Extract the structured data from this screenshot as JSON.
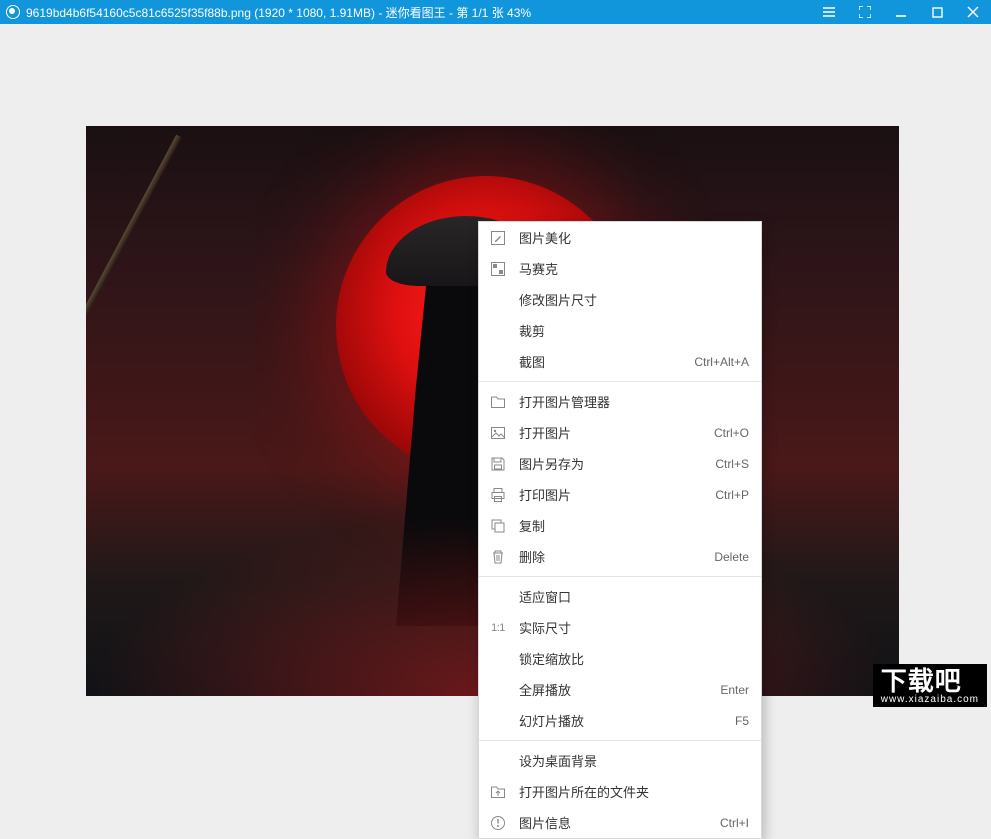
{
  "titlebar": {
    "filename": "9619bd4b6f54160c5c81c6525f35f88b.png",
    "dimensions": "(1920 * 1080, 1.91MB)",
    "appname": "迷你看图王",
    "position": "第 1/1 张",
    "zoom": "43%"
  },
  "menu": {
    "groups": [
      [
        {
          "icon": "edit",
          "label": "图片美化",
          "shortcut": ""
        },
        {
          "icon": "mosaic",
          "label": "马赛克",
          "shortcut": ""
        },
        {
          "icon": "",
          "label": "修改图片尺寸",
          "shortcut": ""
        },
        {
          "icon": "",
          "label": "裁剪",
          "shortcut": ""
        },
        {
          "icon": "",
          "label": "截图",
          "shortcut": "Ctrl+Alt+A"
        }
      ],
      [
        {
          "icon": "folder",
          "label": "打开图片管理器",
          "shortcut": ""
        },
        {
          "icon": "image",
          "label": "打开图片",
          "shortcut": "Ctrl+O"
        },
        {
          "icon": "save",
          "label": "图片另存为",
          "shortcut": "Ctrl+S"
        },
        {
          "icon": "print",
          "label": "打印图片",
          "shortcut": "Ctrl+P"
        },
        {
          "icon": "copy",
          "label": "复制",
          "shortcut": ""
        },
        {
          "icon": "trash",
          "label": "删除",
          "shortcut": "Delete"
        }
      ],
      [
        {
          "icon": "",
          "label": "适应窗口",
          "shortcut": ""
        },
        {
          "icon": "ratio",
          "label": "实际尺寸",
          "shortcut": ""
        },
        {
          "icon": "",
          "label": "锁定缩放比",
          "shortcut": ""
        },
        {
          "icon": "",
          "label": "全屏播放",
          "shortcut": "Enter"
        },
        {
          "icon": "",
          "label": "幻灯片播放",
          "shortcut": "F5"
        }
      ],
      [
        {
          "icon": "",
          "label": "设为桌面背景",
          "shortcut": ""
        },
        {
          "icon": "openfolder",
          "label": "打开图片所在的文件夹",
          "shortcut": ""
        },
        {
          "icon": "info",
          "label": "图片信息",
          "shortcut": "Ctrl+I"
        }
      ]
    ]
  },
  "watermark": {
    "big": "下载吧",
    "small": "www.xiazaiba.com"
  }
}
